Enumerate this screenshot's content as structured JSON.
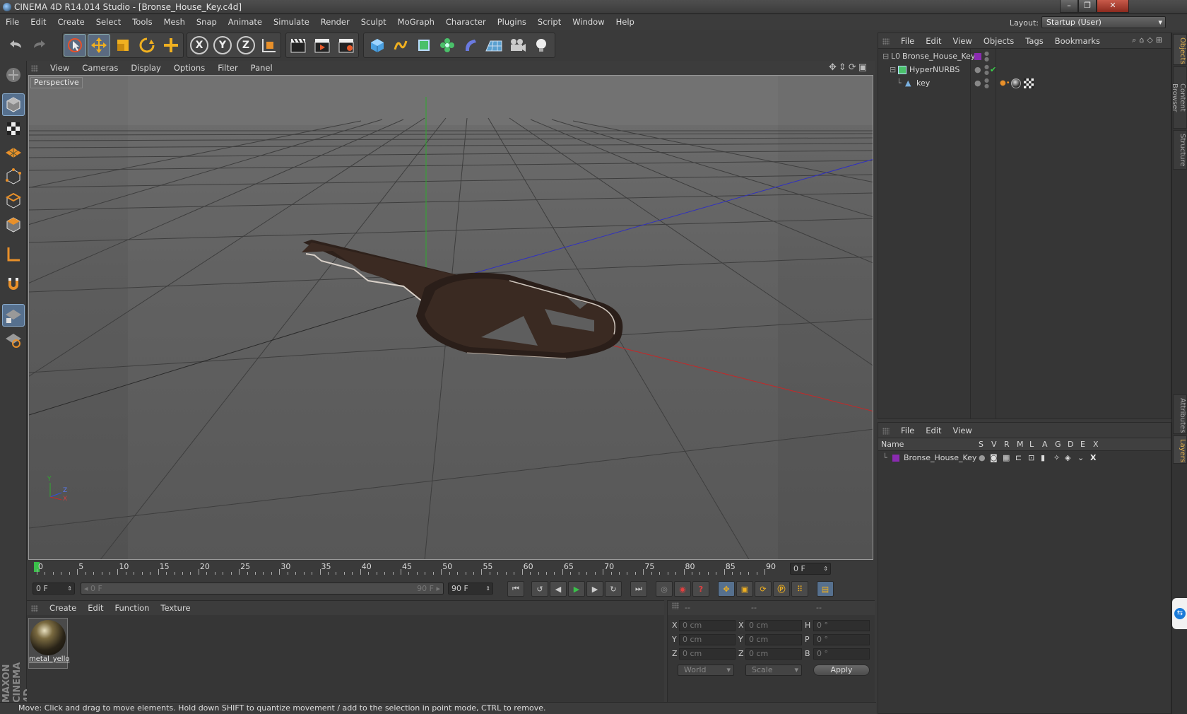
{
  "window": {
    "title": "CINEMA 4D R14.014 Studio - [Bronse_House_Key.c4d]",
    "controls": [
      "–",
      "❐",
      "✕"
    ]
  },
  "menubar": [
    "File",
    "Edit",
    "Create",
    "Select",
    "Tools",
    "Mesh",
    "Snap",
    "Animate",
    "Simulate",
    "Render",
    "Sculpt",
    "MoGraph",
    "Character",
    "Plugins",
    "Script",
    "Window",
    "Help"
  ],
  "layout": {
    "label": "Layout:",
    "value": "Startup (User)"
  },
  "viewport": {
    "menu": [
      "View",
      "Cameras",
      "Display",
      "Options",
      "Filter",
      "Panel"
    ],
    "label": "Perspective",
    "axes": {
      "y": "Y",
      "z": "Z",
      "x": "X"
    }
  },
  "timeline": {
    "ticks": [
      "0",
      "5",
      "10",
      "15",
      "20",
      "25",
      "30",
      "35",
      "40",
      "45",
      "50",
      "55",
      "60",
      "65",
      "70",
      "75",
      "80",
      "85",
      "90"
    ],
    "current_frame": "0 F",
    "start_field": "0 F",
    "range_start": "0 F",
    "range_end": "90 F",
    "end_field": "90 F"
  },
  "material_manager": {
    "menu": [
      "Create",
      "Edit",
      "Function",
      "Texture"
    ],
    "materials": [
      {
        "name": "metal_yello"
      }
    ]
  },
  "coordinates": {
    "headers": [
      "--",
      "--",
      "--"
    ],
    "rows": [
      {
        "a": "X",
        "av": "0 cm",
        "b": "X",
        "bv": "0 cm",
        "c": "H",
        "cv": "0 °"
      },
      {
        "a": "Y",
        "av": "0 cm",
        "b": "Y",
        "bv": "0 cm",
        "c": "P",
        "cv": "0 °"
      },
      {
        "a": "Z",
        "av": "0 cm",
        "b": "Z",
        "bv": "0 cm",
        "c": "B",
        "cv": "0 °"
      }
    ],
    "mode": "World",
    "transform": "Scale",
    "apply": "Apply"
  },
  "status": "Move: Click and drag to move elements. Hold down SHIFT to quantize movement / add to the selection in point mode, CTRL to remove.",
  "object_manager": {
    "menu": [
      "File",
      "Edit",
      "View",
      "Objects",
      "Tags",
      "Bookmarks"
    ],
    "objects": [
      {
        "name": "Bronse_House_Key",
        "depth": 0
      },
      {
        "name": "HyperNURBS",
        "depth": 1
      },
      {
        "name": "key",
        "depth": 2
      }
    ]
  },
  "layer_manager": {
    "menu": [
      "File",
      "Edit",
      "View"
    ],
    "columns": [
      "Name",
      "S",
      "V",
      "R",
      "M",
      "L",
      "A",
      "G",
      "D",
      "E",
      "X"
    ],
    "layers": [
      {
        "name": "Bronse_House_Key",
        "color": "#8a2bb0"
      }
    ]
  },
  "side_tabs": [
    "Objects",
    "Content Browser",
    "Structure",
    "Attributes",
    "Layers"
  ],
  "colors": {
    "accent": "#56708e",
    "layer_purple": "#8a2bb0",
    "key_brown": "#3a2a22"
  }
}
